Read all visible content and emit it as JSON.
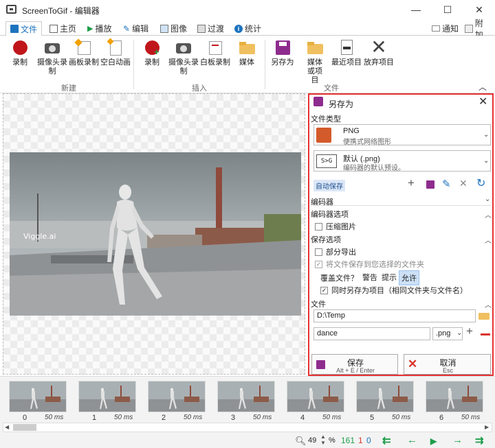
{
  "window": {
    "title": "ScreenToGif - 编辑器",
    "minimize": "—",
    "maximize": "☐",
    "close": "✕"
  },
  "tabs": [
    {
      "label": "文件",
      "icon": "save-icon"
    },
    {
      "label": "主页",
      "icon": "home-icon"
    },
    {
      "label": "播放",
      "icon": "play-icon"
    },
    {
      "label": "编辑",
      "icon": "pencil-icon"
    },
    {
      "label": "图像",
      "icon": "image-icon"
    },
    {
      "label": "过渡",
      "icon": "transition-icon"
    },
    {
      "label": "统计",
      "icon": "info-icon"
    }
  ],
  "tabs_right": {
    "notifications": "通知",
    "extras": "附加"
  },
  "ribbon": {
    "new_group": "新建",
    "insert_group": "插入",
    "file_group": "文件",
    "new": {
      "record": "录制",
      "webcam": "摄像头录制",
      "board": "画板录制",
      "blank": "空白动画"
    },
    "insert": {
      "record": "录制",
      "webcam": "摄像头录制",
      "board": "白板录制",
      "media": "媒体"
    },
    "file": {
      "save_as": "另存为",
      "load": "媒体或项目",
      "recent": "最近项目",
      "discard": "放弃项目"
    }
  },
  "image": {
    "watermark": "Viggle.ai"
  },
  "panel": {
    "title": "另存为",
    "file_type_label": "文件类型",
    "file_type": {
      "name": "PNG",
      "desc": "便携式网络图形"
    },
    "preset": {
      "name": "默认 (.png)",
      "desc": "编码器的默认预设。",
      "icon_text": "S>G"
    },
    "autosave": "自动保存",
    "encoder_label": "编码器",
    "encoder_options_label": "编码器选项",
    "compress": "压缩图片",
    "save_options_label": "保存选项",
    "partial_export": "部分导出",
    "save_to_folder": "将文件保存到您选择的文件夹",
    "overwrite_label": "覆盖文件？",
    "overwrite_warn": "警告",
    "overwrite_prompt": "提示",
    "overwrite_allow": "允许",
    "save_project_too": "同时另存为项目（相同文件夹与文件名）",
    "file_label": "文件",
    "folder": "D:\\Temp",
    "filename": "dance",
    "extension": ".png",
    "save_button": "保存",
    "save_shortcut": "Alt + E / Enter",
    "cancel_button": "取消",
    "cancel_shortcut": "Esc"
  },
  "frames": [
    {
      "index": "0",
      "delay": "50 ms"
    },
    {
      "index": "1",
      "delay": "50 ms"
    },
    {
      "index": "2",
      "delay": "50 ms"
    },
    {
      "index": "3",
      "delay": "50 ms"
    },
    {
      "index": "4",
      "delay": "50 ms"
    },
    {
      "index": "5",
      "delay": "50 ms"
    },
    {
      "index": "6",
      "delay": "50 ms"
    }
  ],
  "status": {
    "zoom": "49",
    "zoom_unit": "%",
    "frame_count": "161",
    "selected": "1",
    "current": "0"
  },
  "colors": {
    "accent": "#1e73be",
    "highlight_border": "#e53030",
    "green": "#1e9e4a",
    "red": "#d9342b",
    "blue": "#1e73be"
  }
}
